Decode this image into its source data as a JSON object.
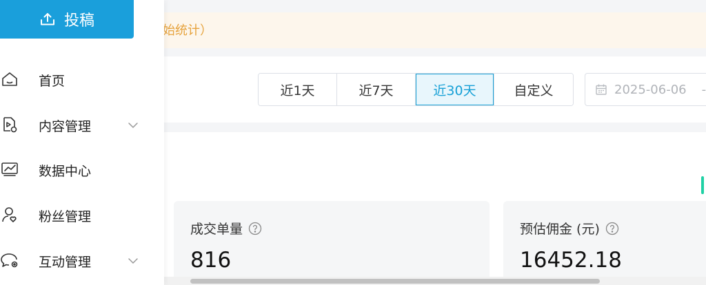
{
  "notice": {
    "text": "始统计）"
  },
  "sidebar": {
    "post_button": {
      "label": "投稿",
      "icon": "upload-icon"
    },
    "items": [
      {
        "label": "首页",
        "icon": "home-icon",
        "has_chevron": false
      },
      {
        "label": "内容管理",
        "icon": "content-doc-icon",
        "has_chevron": true
      },
      {
        "label": "数据中心",
        "icon": "chart-monitor-icon",
        "has_chevron": false
      },
      {
        "label": "粉丝管理",
        "icon": "user-heart-icon",
        "has_chevron": false
      },
      {
        "label": "互动管理",
        "icon": "chat-settings-icon",
        "has_chevron": true
      }
    ]
  },
  "filter": {
    "ranges": [
      "近1天",
      "近7天",
      "近30天",
      "自定义"
    ],
    "selected": "近30天",
    "date_start": "2025-06-06",
    "date_separator": "-"
  },
  "stats": [
    {
      "label": "成交单量",
      "value": "816"
    },
    {
      "label": "预估佣金 (元)",
      "value": "16452.18"
    }
  ],
  "colors": {
    "accent": "#1a9fdb",
    "active_tab": "#16a0d6",
    "notice_text": "#e6a23c",
    "notice_bg": "#fdf6ec"
  }
}
